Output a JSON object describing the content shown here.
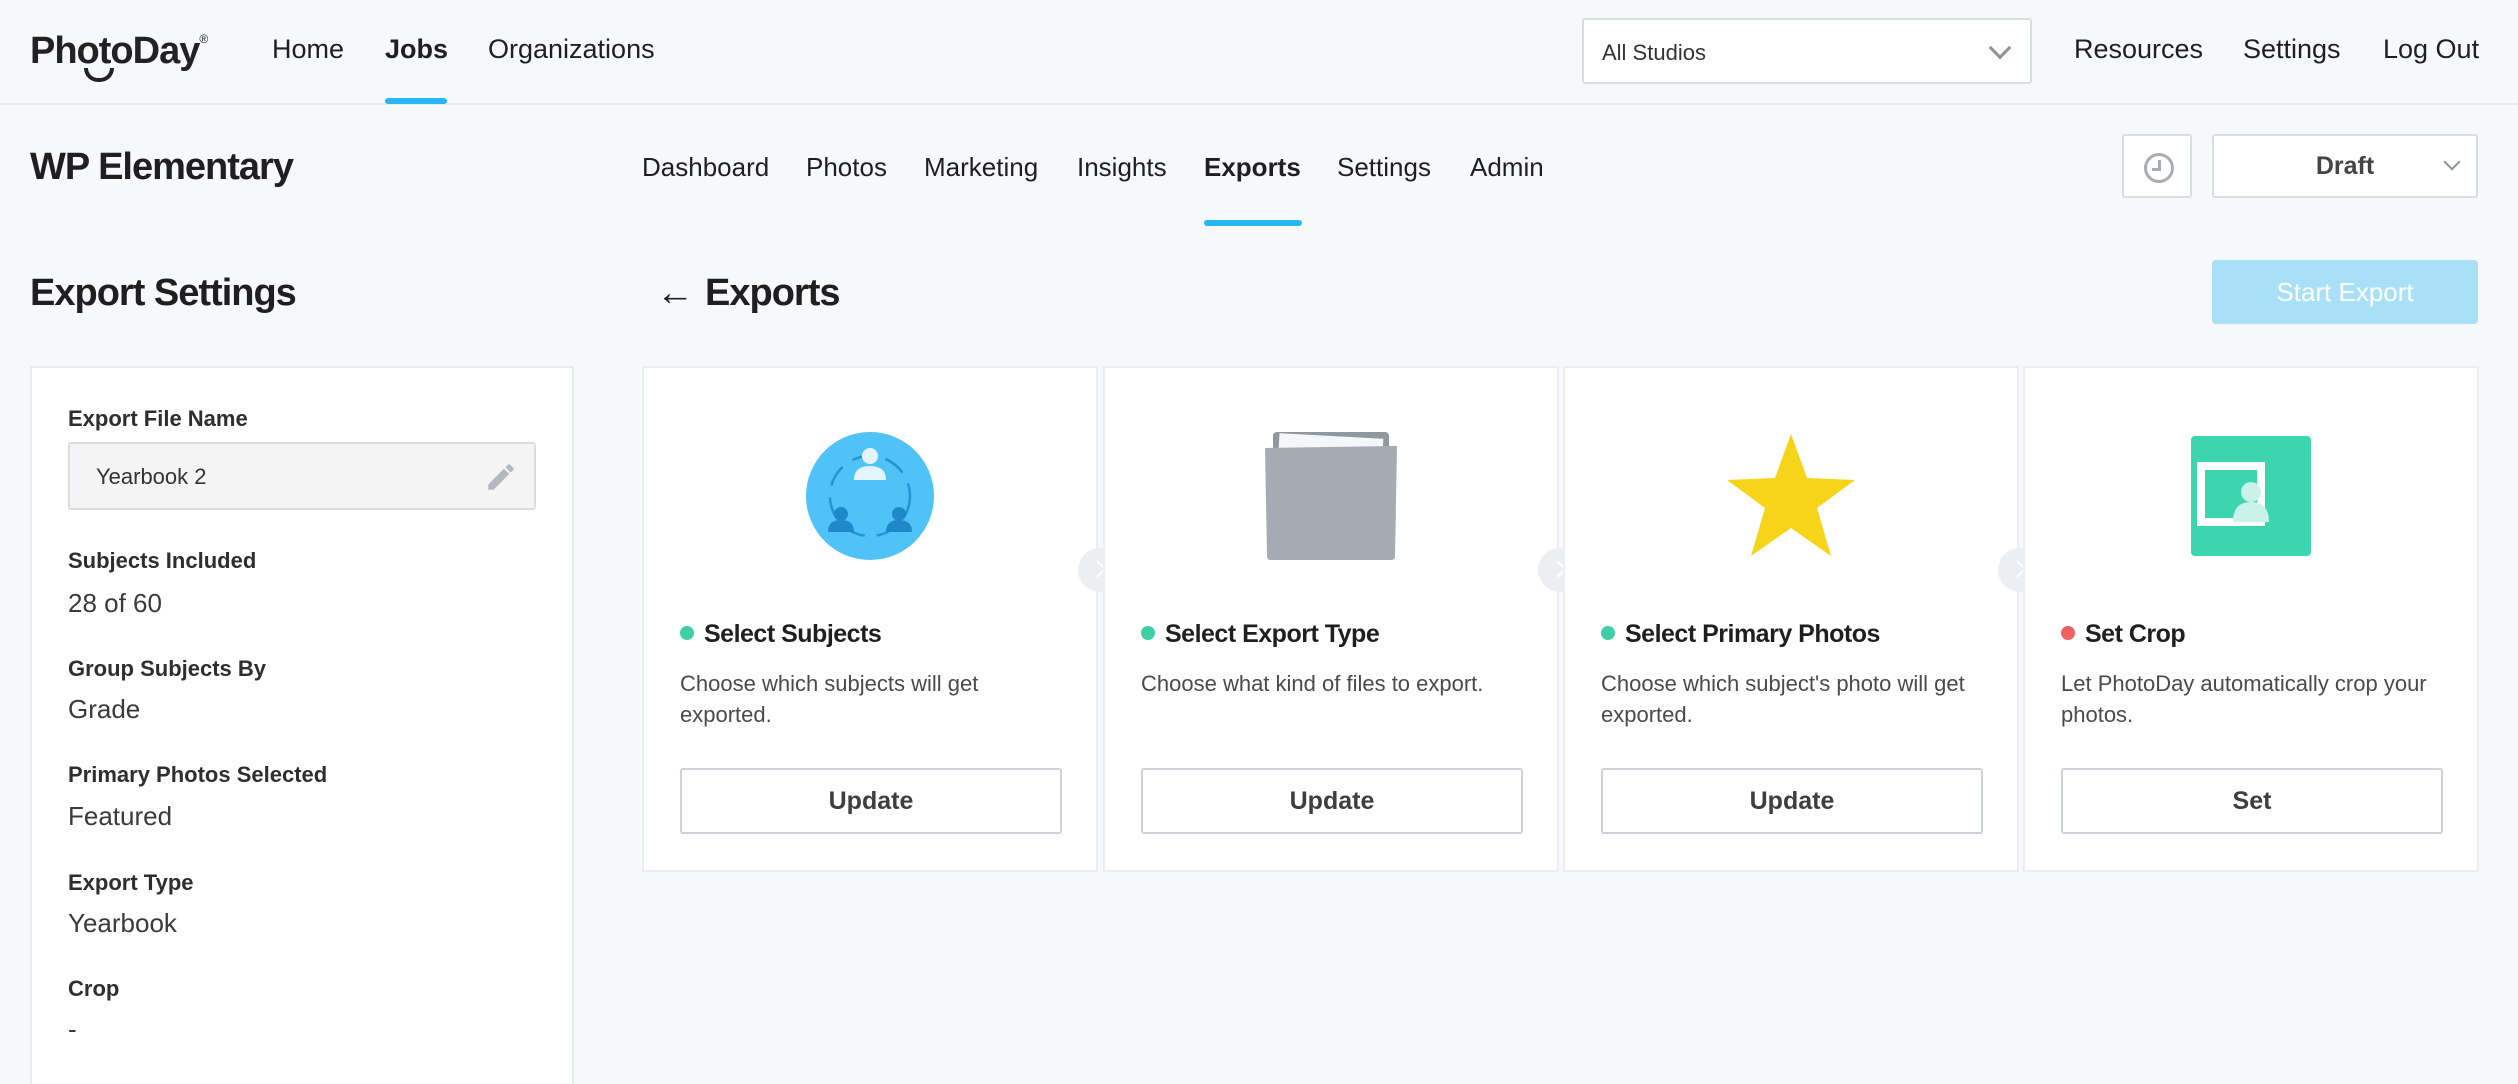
{
  "brand": {
    "logo_text": "PhotoDay"
  },
  "top_nav": {
    "items": [
      {
        "label": "Home"
      },
      {
        "label": "Jobs",
        "active": true
      },
      {
        "label": "Organizations"
      }
    ],
    "studio_select": {
      "value": "All Studios"
    },
    "right_items": [
      {
        "label": "Resources"
      },
      {
        "label": "Settings"
      },
      {
        "label": "Log Out"
      }
    ]
  },
  "job": {
    "title": "WP Elementary",
    "tabs": [
      {
        "label": "Dashboard"
      },
      {
        "label": "Photos"
      },
      {
        "label": "Marketing"
      },
      {
        "label": "Insights"
      },
      {
        "label": "Exports",
        "active": true
      },
      {
        "label": "Settings"
      },
      {
        "label": "Admin"
      }
    ],
    "status_select": {
      "value": "Draft"
    }
  },
  "export_settings": {
    "title": "Export Settings",
    "fields": [
      {
        "label": "Export File Name",
        "value": "Yearbook 2"
      },
      {
        "label": "Subjects Included",
        "value": "28 of 60"
      },
      {
        "label": "Group Subjects By",
        "value": "Grade"
      },
      {
        "label": "Primary Photos Selected",
        "value": "Featured"
      },
      {
        "label": "Export Type",
        "value": "Yearbook"
      },
      {
        "label": "Crop",
        "value": "-"
      }
    ]
  },
  "exports": {
    "back_arrow": "←",
    "title": "Exports",
    "start_button": "Start Export",
    "steps": [
      {
        "icon": "subjects-group-icon",
        "status_color": "#3ecfa5",
        "title": "Select Subjects",
        "description": "Choose which subjects will get exported.",
        "button": "Update"
      },
      {
        "icon": "folder-icon",
        "status_color": "#3ecfa5",
        "title": "Select Export Type",
        "description": "Choose what kind of files to export.",
        "button": "Update"
      },
      {
        "icon": "star-icon",
        "status_color": "#3ecfa5",
        "title": "Select Primary Photos",
        "description": "Choose which subject's photo will get exported.",
        "button": "Update"
      },
      {
        "icon": "crop-portrait-icon",
        "status_color": "#f06262",
        "title": "Set Crop",
        "description": "Let PhotoDay automatically crop your photos.",
        "button": "Set"
      }
    ]
  },
  "colors": {
    "accent": "#29b6f6",
    "start_button_disabled": "#a8e0f8",
    "status_complete": "#3ecfa5",
    "status_incomplete": "#f06262"
  }
}
